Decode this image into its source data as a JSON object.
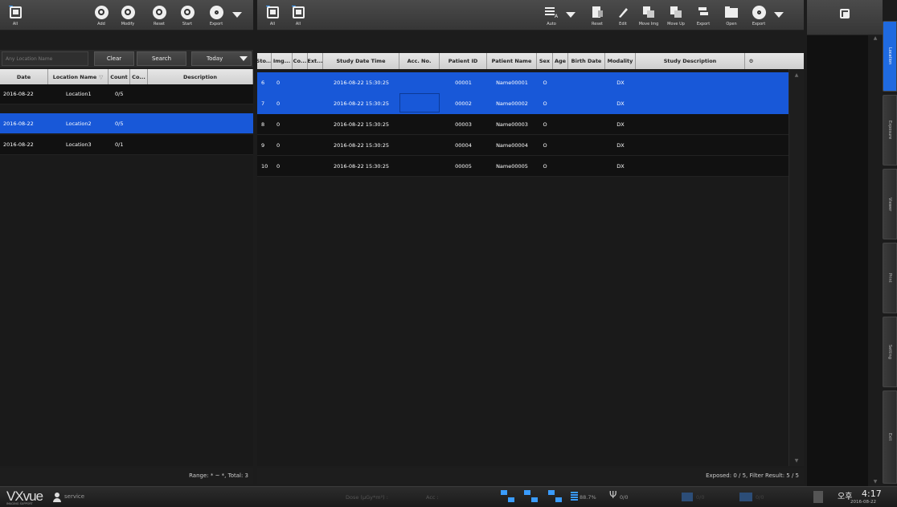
{
  "left_toolbar": {
    "all_label": "All",
    "buttons": [
      "Add",
      "Modify",
      "Reset",
      "Start",
      "Export"
    ]
  },
  "left_filter": {
    "search_placeholder": "Any Location Name",
    "clear_label": "Clear",
    "search_label": "Search",
    "date_filter": "Today"
  },
  "location_table": {
    "columns": [
      "Date",
      "Location Name",
      "Count",
      "Co...",
      "Description"
    ],
    "rows": [
      {
        "date": "2016-08-22",
        "name": "Location1",
        "count": "0/5",
        "selected": false
      },
      {
        "date": "2016-08-22",
        "name": "Location2",
        "count": "0/5",
        "selected": true
      },
      {
        "date": "2016-08-22",
        "name": "Location3",
        "count": "0/1",
        "selected": false
      }
    ]
  },
  "left_footer": "Range: * ~ *, Total: 3",
  "main_toolbar": {
    "all_labels": [
      "All",
      "All"
    ],
    "buttons": [
      "Auto",
      "Reset",
      "Edit",
      "Move Img",
      "Move Up",
      "Export",
      "Open",
      "Export"
    ]
  },
  "study_table": {
    "columns": [
      "Sto...",
      "Img...",
      "Co...",
      "Ext...",
      "Study Date Time",
      "Acc. No.",
      "Patient ID",
      "Patient Name",
      "Sex",
      "Age",
      "Birth Date",
      "Modality",
      "Study Description"
    ],
    "rows": [
      {
        "sto": "6",
        "img": "0",
        "datetime": "2016-08-22 15:30:25",
        "pid": "00001",
        "pname": "Name00001",
        "sex": "O",
        "modality": "DX",
        "selected": true
      },
      {
        "sto": "7",
        "img": "0",
        "datetime": "2016-08-22 15:30:25",
        "pid": "00002",
        "pname": "Name00002",
        "sex": "O",
        "modality": "DX",
        "selected": true
      },
      {
        "sto": "8",
        "img": "0",
        "datetime": "2016-08-22 15:30:25",
        "pid": "00003",
        "pname": "Name00003",
        "sex": "O",
        "modality": "DX",
        "selected": false
      },
      {
        "sto": "9",
        "img": "0",
        "datetime": "2016-08-22 15:30:25",
        "pid": "00004",
        "pname": "Name00004",
        "sex": "O",
        "modality": "DX",
        "selected": false
      },
      {
        "sto": "10",
        "img": "0",
        "datetime": "2016-08-22 15:30:25",
        "pid": "00005",
        "pname": "Name00005",
        "sex": "O",
        "modality": "DX",
        "selected": false
      }
    ]
  },
  "main_footer": "Exposed: 0 / 5, Filter Result: 5 / 5",
  "side_tabs": [
    "Location",
    "Exposure",
    "Viewer",
    "Print",
    "Setting",
    "Exit"
  ],
  "statusbar": {
    "logo": "VXvue",
    "logo_sub": "IMAGING SUPPORT",
    "user": "service",
    "dose": "Dose (μGy*m²) :",
    "acc": "Acc :",
    "disk": "88.7%",
    "usb": "0/0",
    "upload": "0/0",
    "print": "0/0",
    "ampm": "오후",
    "time": "4:17",
    "date": "2016-08-22"
  },
  "colors": {
    "selection": "#1858d8",
    "accent": "#3a9cff",
    "background": "#1c1c1c"
  }
}
